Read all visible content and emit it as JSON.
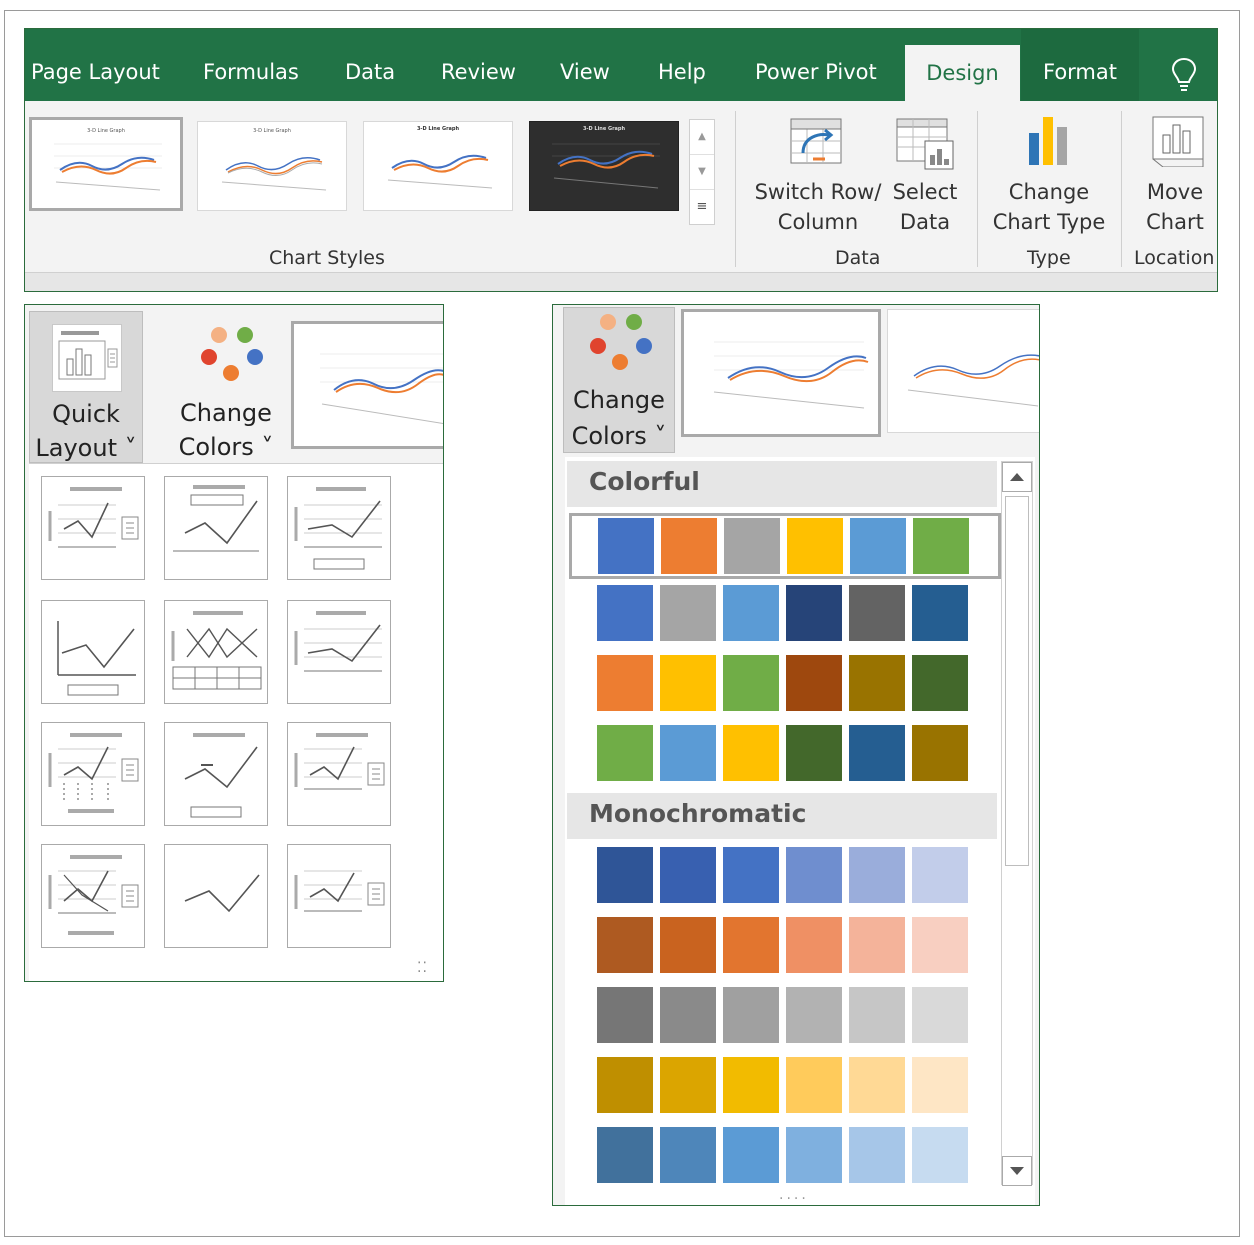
{
  "ribbon": {
    "tabs": [
      "Page Layout",
      "Formulas",
      "Data",
      "Review",
      "View",
      "Help",
      "Power Pivot",
      "Design",
      "Format"
    ],
    "active_tab": "Design",
    "groups": {
      "chart_styles": "Chart Styles",
      "data": "Data",
      "type": "Type",
      "location": "Location"
    },
    "buttons": {
      "switch_row_1": "Switch Row/",
      "switch_row_2": "Column",
      "select_data_1": "Select",
      "select_data_2": "Data",
      "change_type_1": "Change",
      "change_type_2": "Chart Type",
      "move_chart_1": "Move",
      "move_chart_2": "Chart"
    },
    "thumb_titles": [
      "3-D Line Graph",
      "3-D Line Graph",
      "3-D Line Graph",
      "3-D Line Graph"
    ]
  },
  "quick_layout_panel": {
    "quick_1": "Quick",
    "quick_2": "Layout ˅",
    "colors_1": "Change",
    "colors_2": "Colors ˅",
    "layouts": [
      "layout-1",
      "layout-2",
      "layout-3",
      "layout-4",
      "layout-5",
      "layout-6",
      "layout-7",
      "layout-8",
      "layout-9",
      "layout-10",
      "layout-11",
      "layout-12"
    ]
  },
  "change_colors_panel": {
    "colors_1": "Change",
    "colors_2": "Colors ˅",
    "colorful_header": "Colorful",
    "monochromatic_header": "Monochromatic",
    "colorful": [
      [
        "#4472c4",
        "#ed7d31",
        "#a5a5a5",
        "#ffc000",
        "#5b9bd5",
        "#70ad47"
      ],
      [
        "#4472c4",
        "#a5a5a5",
        "#5b9bd5",
        "#264478",
        "#636363",
        "#255e91"
      ],
      [
        "#ed7d31",
        "#ffc000",
        "#70ad47",
        "#9e480e",
        "#997300",
        "#43682b"
      ],
      [
        "#70ad47",
        "#5b9bd5",
        "#ffc000",
        "#43682b",
        "#255e91",
        "#997300"
      ]
    ],
    "monochromatic": [
      [
        "#2f5597",
        "#3860b0",
        "#4472c4",
        "#6f8ecf",
        "#9aaddb",
        "#c2cdea"
      ],
      [
        "#ae5a21",
        "#c9631f",
        "#e2752f",
        "#ef9064",
        "#f4b39a",
        "#f8cfc1"
      ],
      [
        "#767676",
        "#8a8a8a",
        "#a0a0a0",
        "#b2b2b2",
        "#c6c6c6",
        "#d9d9d9"
      ],
      [
        "#bf8f00",
        "#dba500",
        "#f2bb00",
        "#ffcb5b",
        "#ffd995",
        "#fee6c5"
      ],
      [
        "#41719c",
        "#4e86ba",
        "#5b9bd5",
        "#7fb0df",
        "#a6c6e8",
        "#c6dbf0"
      ]
    ]
  },
  "colors": {
    "excel_green": "#217346",
    "ribbon_bg": "#f3f3f3"
  }
}
